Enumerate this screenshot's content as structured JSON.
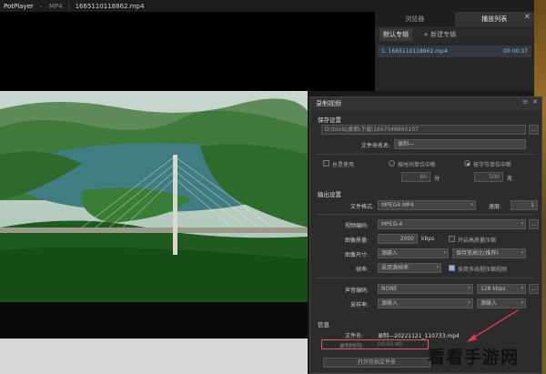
{
  "titlebar": {
    "app": "PotPlayer",
    "format": "MP4",
    "file": "1665110118862.mp4"
  },
  "playlist": {
    "tabs": [
      "浏览器",
      "播放列表"
    ],
    "sub": [
      "默认专辑",
      "+ 新建专辑"
    ],
    "item_name": "1. 1665110118862.mp4",
    "item_duration": "00:00:37"
  },
  "dialog": {
    "title": "录制视频",
    "save": {
      "heading": "保存设置",
      "path": "D:\\tools\\桌面\\下载\\1667048660107",
      "filename_label": "文件命名名:",
      "filename_value": "录制—",
      "always_use": "总是使用",
      "by_time": "按时间单位中断",
      "by_bytes": "按字节单位中断",
      "time_value": "60",
      "time_unit": "分",
      "bytes_value": "500",
      "bytes_unit": "兆"
    },
    "output": {
      "heading": "输出设置",
      "format_label": "文件格式:",
      "format_value": "MPEG4 MP4",
      "speed_label": "速度:",
      "speed_value": "1",
      "vcodec_label": "视频编码:",
      "vcodec_value": "MPEG-4",
      "quality_label": "图像质量:",
      "quality_value": "2000",
      "quality_unit": "kbps",
      "hw_label": "开启高质量压缩",
      "size_label": "图像尺寸:",
      "size_value": "源输入",
      "aspect_value": "保持宽高比(推荐)",
      "fps_label": "帧率:",
      "fps_value": "采用源帧率",
      "multithread_label": "采用多线程压缩视频",
      "acodec_label": "声音编码:",
      "acodec_value": "NONE",
      "abitrate_value": "128 kbps",
      "samplerate_label": "采样率:",
      "samplerate_value": "源输入",
      "channels_value": "源输入"
    },
    "info": {
      "heading": "信息",
      "filename_label": "文件名:",
      "filename_value": "录制—20221121_110733.mp4",
      "elapsed_label": "录制时间:",
      "elapsed_value": "00:00:40",
      "open_folder": "打开存档文件夹"
    }
  },
  "watermark": "看看手游网"
}
